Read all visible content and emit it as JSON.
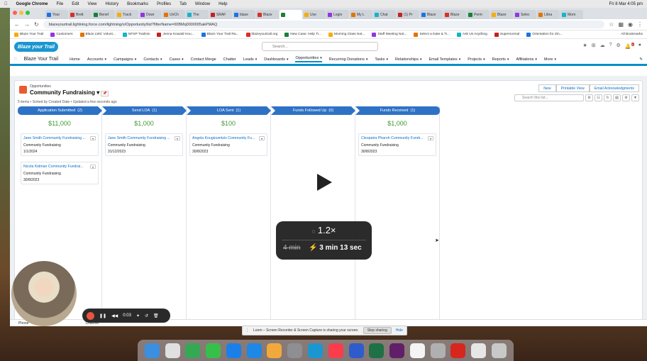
{
  "menubar": {
    "apple": "",
    "app": "Google Chrome",
    "items": [
      "File",
      "Edit",
      "View",
      "History",
      "Bookmarks",
      "Profiles",
      "Tab",
      "Window",
      "Help"
    ],
    "datetime": "Fri 8 Mar 4:05 pm"
  },
  "browser": {
    "tabs": [
      "Your",
      "Brett",
      "Benef",
      "Track",
      "Dowr",
      "UnCh",
      "The",
      "SRAF",
      "blaze",
      "Blaze",
      "",
      "Use",
      "Login",
      "My L",
      "Chat",
      "(1) Pr",
      "Blaze",
      "Blaze",
      "Perm",
      "Blaze",
      "Selec",
      "Libra",
      "Morn"
    ],
    "url": "blazeyourtrail.lightning.force.com/lightning/o/Opportunity/list?filterName=00BMq0000005akPMAQ",
    "bookmarks": [
      "Blaze Your Trail",
      "Customers",
      "Blaze LWC Volunt...",
      "NFSP Trailmix",
      "Jenna Kowald Hou...",
      "Blaze Your Trail Ra...",
      "blazeyourtrail.org",
      "New Case: Help Ti...",
      "Morning Class Not...",
      "Staff Meeting Not...",
      "Select a Date & Ti...",
      "Ask Us Anything",
      "Supernormal",
      "Orientation for Zin..."
    ],
    "all_bookmarks": "All Bookmarks"
  },
  "sf": {
    "logo": "Blaze your Trail",
    "search_placeholder": "Search...",
    "app_name": "Blaze Your Trail",
    "nav": [
      "Home",
      "Accounts",
      "Campaigns",
      "Contacts",
      "Cases",
      "Contact Merge",
      "Chatter",
      "Leads",
      "Dashboards",
      "Opportunities",
      "Recurring Donations",
      "Tasks",
      "Relationships",
      "Email Templates",
      "Projects",
      "Reports",
      "Affiliations",
      "More"
    ],
    "notif_count": "6",
    "object_label": "Opportunities",
    "list_title": "Community Fundraising",
    "meta": "5 items • Sorted by Created Date • Updated a few seconds ago",
    "buttons": [
      "New",
      "Printable View",
      "Email Acknowledgments"
    ],
    "list_search_placeholder": "Search this list..."
  },
  "stages": [
    {
      "name": "Application Submitted",
      "count": "(2)",
      "amount": "$11,000",
      "records": [
        {
          "name": "Jane Smith Community Fundraising ...",
          "type": "Community Fundraising",
          "date": "1/1/2024"
        },
        {
          "name": "Nicola Kidman Community Fundrai...",
          "type": "Community Fundraising",
          "date": "30/8/2023"
        }
      ]
    },
    {
      "name": "Send LOA",
      "count": "(1)",
      "amount": "$1,000",
      "records": [
        {
          "name": "Jane Smith Community Fundraising ...",
          "type": "Community Fundraising",
          "date": "31/12/2023"
        }
      ]
    },
    {
      "name": "LOA Sent",
      "count": "(1)",
      "amount": "$100",
      "records": [
        {
          "name": "Angela Kougioumtzis Community Fu...",
          "type": "Community Fundraising",
          "date": "30/8/2023"
        }
      ]
    },
    {
      "name": "Funds Followed Up",
      "count": "(0)",
      "amount": "",
      "records": []
    },
    {
      "name": "Funds Received",
      "count": "(1)",
      "amount": "$1,000",
      "records": [
        {
          "name": "Cleopatra Pharoh Community Fundr...",
          "type": "Community Fundraising",
          "date": "30/8/2023"
        }
      ]
    }
  ],
  "player": {
    "rate": "1.2×",
    "original": "4 min",
    "new": "3 min 13 sec"
  },
  "recorder": {
    "time": "0:03"
  },
  "phone_bar": [
    "Phone",
    "Channel"
  ],
  "share": {
    "text": "Loom – Screen Recorder & Screen Capture is sharing your screen.",
    "stop": "Stop sharing",
    "hide": "Hide"
  },
  "colors": {
    "accent": "#0b8ec7",
    "stage": "#2e72c6",
    "amount": "#3f9a31",
    "record_link": "#0b6ec7",
    "stop": "#e8543f"
  }
}
